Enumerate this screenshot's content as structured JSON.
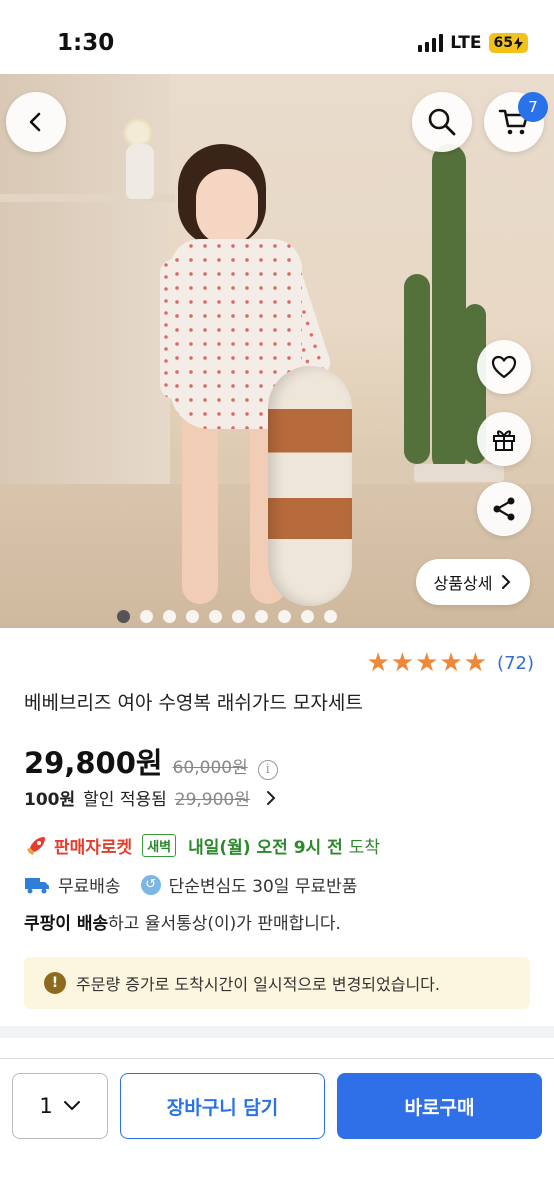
{
  "status_bar": {
    "time": "1:30",
    "network": "LTE",
    "battery": "65"
  },
  "header": {
    "cart_count": "7"
  },
  "gallery": {
    "detail_label": "상품상세",
    "slide_count": 10,
    "active_slide": 1
  },
  "product": {
    "rating_stars": 5,
    "review_count": "(72)",
    "title": "베베브리즈 여아 수영복 래쉬가드 모자세트",
    "price": "29,800원",
    "original_price": "60,000원",
    "discount_amount": "100원",
    "discount_text": "할인 적용됨",
    "pre_discount_price": "29,900원"
  },
  "delivery": {
    "rocket_label": "판매자로켓",
    "dawn_badge": "새벽",
    "arrival": "내일(월) 오전 9시 전",
    "arrival_suffix": "도착",
    "free_shipping": "무료배송",
    "free_return": "단순변심도 30일 무료반품",
    "seller_bold": "쿠팡이 배송",
    "seller_rest": "하고 율서통상(이)가 판매합니다.",
    "notice": "주문량 증가로 도착시간이 일시적으로 변경되었습니다."
  },
  "bottom_bar": {
    "quantity": "1",
    "add_to_cart": "장바구니 담기",
    "buy_now": "바로구매"
  },
  "colors": {
    "accent": "#2f6fe8",
    "star": "#f0883a",
    "rocket": "#e53d2c",
    "green": "#2c8a2c",
    "notice_bg": "#fdf6df"
  }
}
